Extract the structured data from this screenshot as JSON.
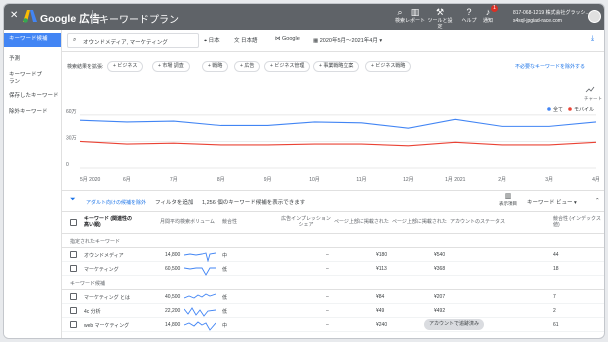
{
  "app": {
    "title": "Google 広告",
    "page_title": "キーワードプラン"
  },
  "tools": [
    {
      "label": "検索",
      "icon": "search-icon"
    },
    {
      "label": "レポート",
      "icon": "bar-chart-icon"
    },
    {
      "label": "ツールと設定",
      "icon": "wrench-icon"
    },
    {
      "label": "ヘルプ",
      "icon": "help-icon"
    },
    {
      "label": "通知",
      "icon": "bell-icon"
    }
  ],
  "notification_count": "1",
  "account": {
    "line1": "817-068-1219 株式会社グラッシ...",
    "line2": "s4sql-jpgiad-race.com"
  },
  "sidebar": {
    "items": [
      "キーワード候補",
      "予測",
      "キーワードプラン",
      "保存したキーワード",
      "除外キーワード"
    ]
  },
  "filters": {
    "search": "オウンドメディア, マーケティング",
    "location": "日本",
    "language": "日本語",
    "network": "Google",
    "date_range": "2020年5月～2021年4月"
  },
  "refine": {
    "label": "検索結果を拡張:",
    "chips": [
      "ビジネス",
      "市場 調査",
      "戦略",
      "広告",
      "ビジネス管理",
      "事業戦略立案",
      "ビジネス戦略"
    ],
    "link": "不必要なキーワードを除外する"
  },
  "chart_data": {
    "type": "line",
    "x": [
      "5月 2020",
      "6月",
      "7月",
      "8月",
      "9月",
      "10月",
      "11月",
      "12月",
      "1月 2021",
      "2月",
      "3月",
      "4月"
    ],
    "yticks": [
      "60万",
      "30万",
      "0"
    ],
    "ylim": [
      0,
      700000
    ],
    "series": [
      {
        "name": "全て",
        "color": "#4285f4",
        "values": [
          540000,
          520000,
          530000,
          480000,
          480000,
          520000,
          510000,
          450000,
          550000,
          470000,
          470000,
          520000
        ]
      },
      {
        "name": "モバイル",
        "color": "#ea4335",
        "values": [
          300000,
          270000,
          280000,
          260000,
          260000,
          270000,
          270000,
          250000,
          290000,
          260000,
          260000,
          290000
        ]
      }
    ],
    "menu_label": "チャート",
    "legend": "top-right"
  },
  "table_bar": {
    "filter_text": "アダルト向けの候補を除外",
    "add_filter": "フィルタを追加",
    "count_text": "1,256 個のキーワード候補を表示できます",
    "columns_label": "表示項目",
    "view_label": "キーワード ビュー"
  },
  "columns": [
    "キーワード (関連性の高い順)",
    "月間平均検索ボリューム",
    "競合性",
    "広告インプレッション シェア",
    "ページ上部に掲載された",
    "ページ上部に掲載された",
    "アカウントのステータス",
    "競合性 (インデックス値)"
  ],
  "groups": {
    "provided": "指定されたキーワード",
    "ideas": "キーワード候補"
  },
  "rows_provided": [
    {
      "kw": "オウンドメディア",
      "vol": "14,800",
      "comp": "中",
      "imp": "–",
      "bid_low": "¥180",
      "bid_high": "¥540",
      "status": "",
      "idx": "44"
    },
    {
      "kw": "マーケティング",
      "vol": "60,500",
      "comp": "低",
      "imp": "–",
      "bid_low": "¥113",
      "bid_high": "¥368",
      "status": "",
      "idx": "18"
    }
  ],
  "rows_ideas": [
    {
      "kw": "マーケティング とは",
      "vol": "40,500",
      "comp": "低",
      "imp": "–",
      "bid_low": "¥84",
      "bid_high": "¥207",
      "status": "",
      "idx": "7"
    },
    {
      "kw": "4c 分析",
      "vol": "22,200",
      "comp": "低",
      "imp": "–",
      "bid_low": "¥49",
      "bid_high": "¥492",
      "status": "",
      "idx": "2"
    },
    {
      "kw": "web マーケティング",
      "vol": "14,800",
      "comp": "中",
      "imp": "–",
      "bid_low": "¥240",
      "bid_high": "¥736",
      "status": "アカウントで追跡済み",
      "idx": "61"
    }
  ]
}
